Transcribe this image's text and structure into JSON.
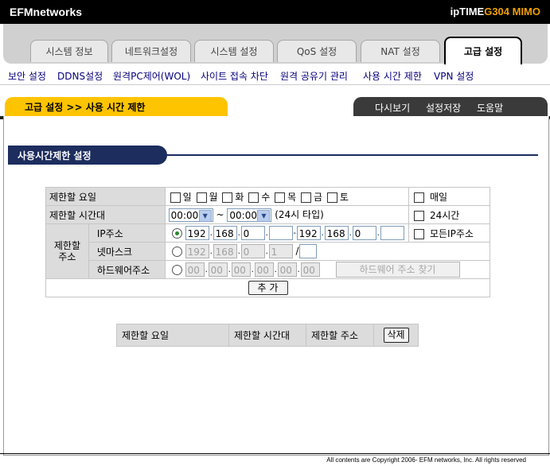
{
  "header": {
    "brand": "EFMnetworks",
    "product_prefix": "ipTIME",
    "product_model": "G304 MIMO"
  },
  "tabs": [
    "시스템 정보",
    "네트워크설정",
    "시스템 설정",
    "QoS 설정",
    "NAT 설정",
    "고급 설정"
  ],
  "submenu": [
    "보안 설정",
    "DDNS설정",
    "원격PC제어(WOL)",
    "사이트 접속 차단",
    "원격 공유기 관리",
    "사용 시간 제한",
    "VPN 설정"
  ],
  "breadcrumb": "고급 설정 >> 사용 시간 제한",
  "toolbar": {
    "refresh": "다시보기",
    "save": "설정저장",
    "help": "도움말"
  },
  "section_title": "사용시간제한 설정",
  "form": {
    "day_label": "제한할 요일",
    "days": [
      "일",
      "월",
      "화",
      "수",
      "목",
      "금",
      "토"
    ],
    "everyday": "매일",
    "time_label": "제한할 시간대",
    "time_start": "00:00",
    "time_end": "00:00",
    "time_sep": "~",
    "time_note": "(24시 타입)",
    "allday": "24시간",
    "addr_label": "제한할 주소",
    "ip_label": "IP주소",
    "ip_start": [
      "192",
      "168",
      "0",
      ""
    ],
    "ip_end": [
      "192",
      "168",
      "0",
      ""
    ],
    "all_ip": "모든IP주소",
    "netmask_label": "넷마스크",
    "netmask": [
      "192",
      "168",
      "0",
      "1"
    ],
    "netmask_slash": "/",
    "hw_label": "하드웨어주소",
    "hw": [
      "00",
      "00",
      "00",
      "00",
      "00",
      "00"
    ],
    "hw_find": "하드웨어 주소 찾기",
    "add_button": "추 가"
  },
  "list": {
    "col_day": "제한할 요일",
    "col_time": "제한할 시간대",
    "col_addr": "제한할 주소",
    "delete": "삭제"
  },
  "footer": "All contents are Copyright  2006- EFM networks, Inc. All rights reserved"
}
